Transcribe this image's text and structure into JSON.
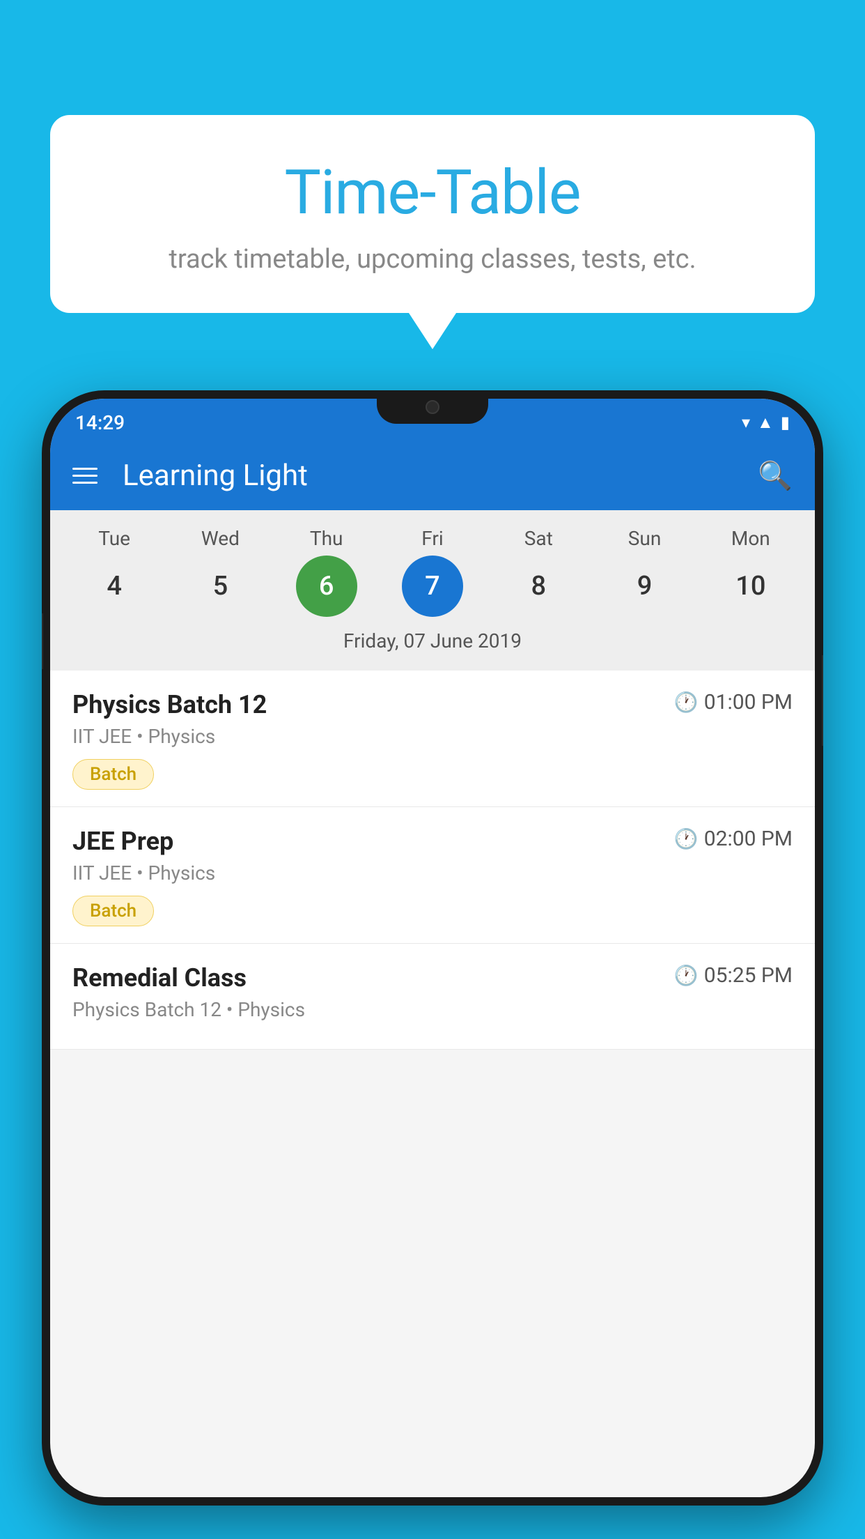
{
  "background_color": "#18B8E8",
  "bubble": {
    "title": "Time-Table",
    "subtitle": "track timetable, upcoming classes, tests, etc."
  },
  "phone": {
    "status_bar": {
      "time": "14:29"
    },
    "app_bar": {
      "title": "Learning Light"
    },
    "calendar": {
      "days": [
        {
          "label": "Tue",
          "number": "4"
        },
        {
          "label": "Wed",
          "number": "5"
        },
        {
          "label": "Thu",
          "number": "6",
          "state": "today"
        },
        {
          "label": "Fri",
          "number": "7",
          "state": "selected"
        },
        {
          "label": "Sat",
          "number": "8"
        },
        {
          "label": "Sun",
          "number": "9"
        },
        {
          "label": "Mon",
          "number": "10"
        }
      ],
      "selected_date": "Friday, 07 June 2019"
    },
    "schedule": [
      {
        "title": "Physics Batch 12",
        "time": "01:00 PM",
        "subtitle": "IIT JEE • Physics",
        "badge": "Batch"
      },
      {
        "title": "JEE Prep",
        "time": "02:00 PM",
        "subtitle": "IIT JEE • Physics",
        "badge": "Batch"
      },
      {
        "title": "Remedial Class",
        "time": "05:25 PM",
        "subtitle": "Physics Batch 12 • Physics",
        "badge": ""
      }
    ]
  }
}
